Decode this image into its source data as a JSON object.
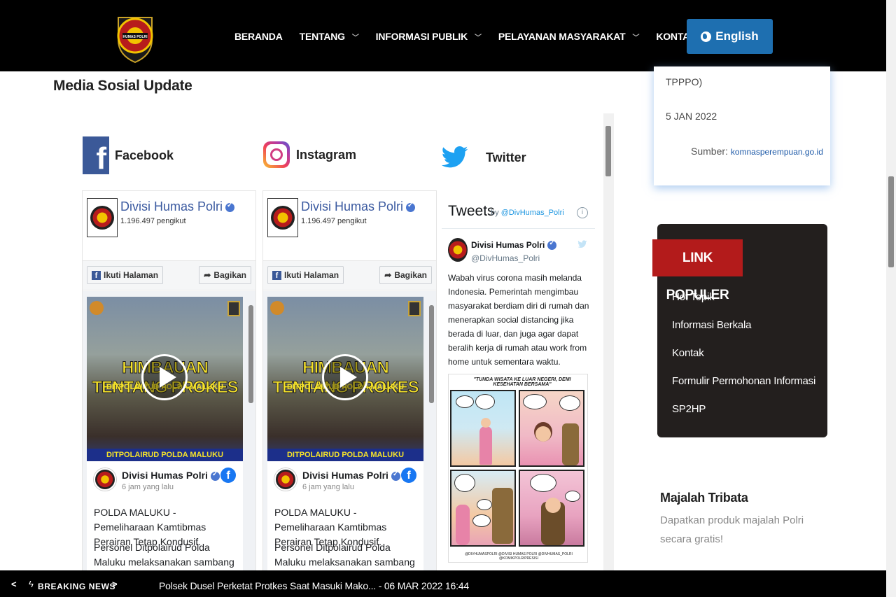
{
  "nav": {
    "items": [
      {
        "label": "BERANDA",
        "has_dropdown": false
      },
      {
        "label": "TENTANG",
        "has_dropdown": true
      },
      {
        "label": "INFORMASI PUBLIK",
        "has_dropdown": true
      },
      {
        "label": "PELAYANAN MASYARAKAT",
        "has_dropdown": true
      },
      {
        "label": "KONTAK",
        "has_dropdown": false
      }
    ],
    "language_button": "English",
    "logo_text": "HUMAS POLRI"
  },
  "section": {
    "title": "Media Sosial Update",
    "facebook_label": "Facebook",
    "instagram_label": "Instagram",
    "twitter_label": "Twitter"
  },
  "facebook_widget": {
    "page_name": "Divisi Humas Polri",
    "followers": "1.196.497 pengikut",
    "follow_button": "Ikuti Halaman",
    "share_button": "Bagikan",
    "video_title": "HIMBAUAN TENTANG PROKES",
    "video_subtitle": "DITPOLAIRUD POLDA MALUKU",
    "video_footer": "DITPOLAIRUD POLDA MALUKU",
    "post_author": "Divisi Humas Polri",
    "post_time": "6 jam yang lalu",
    "post_text_1": "POLDA MALUKU - Pemeliharaan Kamtibmas Perairan Tetap Kondusif.",
    "post_text_2": "Personel Ditpolairud Polda Maluku melaksanakan sambang dan"
  },
  "instagram_widget": {
    "page_name": "Divisi Humas Polri",
    "followers": "1.196.497 pengikut",
    "follow_button": "Ikuti Halaman",
    "share_button": "Bagikan",
    "video_title": "HIMBAUAN TENTANG PROKES",
    "video_subtitle": "DITPOLAIRUD POLDA MALUKU",
    "video_footer": "DITPOLAIRUD POLDA MALUKU",
    "post_author": "Divisi Humas Polri",
    "post_time": "6 jam yang lalu",
    "post_text_1": "POLDA MALUKU - Pemeliharaan Kamtibmas Perairan Tetap Kondusif.",
    "post_text_2": "Personel Ditpolairud Polda Maluku melaksanakan sambang dan"
  },
  "twitter_widget": {
    "title": "Tweets",
    "by_prefix": "by",
    "handle_link": "@DivHumas_Polri",
    "info_icon": "i",
    "tweet_author": "Divisi Humas Polri",
    "tweet_handle": "@DivHumas_Polri",
    "tweet_text": "Wabah virus corona masih melanda Indonesia. Pemerintah mengimbau masyarakat berdiam diri di rumah dan menerapkan social distancing jika berada di luar, dan juga agar dapat beralih kerja di rumah atau work from home untuk sementara waktu.",
    "comic_title": "\"TUNDA WISATA KE LUAR NEGERI, DEMI KESEHATAN BERSAMA\"",
    "comic_footer": "@DIVHUMASPOLRI  @DIVISI HUMAS POLRI  @DIVHUMAS_POLRI  @KOMIKPOLRIPRESISI"
  },
  "news_card": {
    "line1": "TPPPO)",
    "date": "5 JAN 2022",
    "source_label": "Sumber:",
    "source_link": "komnasperempuan.go.id"
  },
  "popular_links": {
    "title": "LINK POPULER",
    "items": [
      "Hot Topik",
      "Informasi Berkala",
      "Kontak",
      "Formulir Permohonan Informasi",
      "SP2HP"
    ]
  },
  "magazine": {
    "title": "Majalah Tribata",
    "description": "Dapatkan produk majalah Polri secara gratis!"
  },
  "breaking_news": {
    "prev": "<",
    "label": "BREAKING NEWS",
    "next": ">",
    "headline": "Polsek Dusel Perketat Protkes Saat Masuki Mako... - 06 MAR 2022 16:44"
  },
  "colors": {
    "nav_bg": "#000000",
    "lang_button": "#1e6fb0",
    "facebook_blue": "#3b5998",
    "twitter_blue": "#1da1f2",
    "popular_tag_red": "#b31b1b",
    "popular_box_bg": "#231f1e"
  }
}
